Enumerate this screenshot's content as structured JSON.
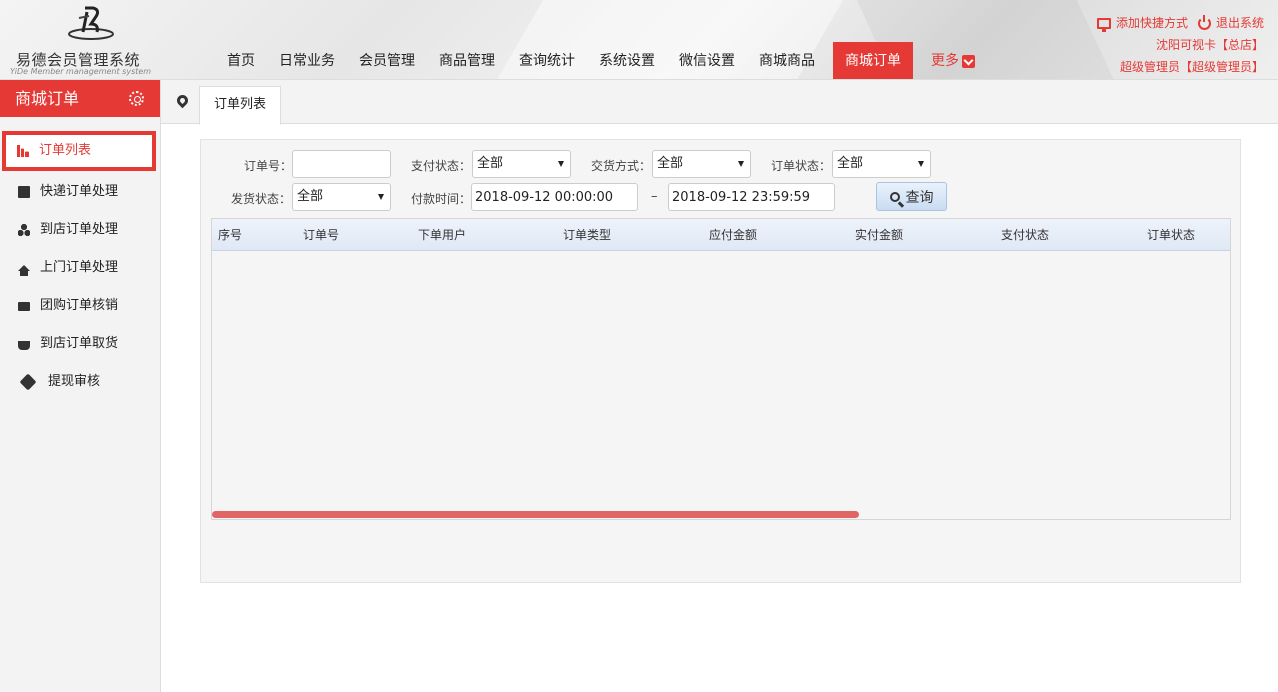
{
  "logo": {
    "title": "易德会员管理系统",
    "subtitle": "YiDe Member management system"
  },
  "nav": {
    "items": [
      "首页",
      "日常业务",
      "会员管理",
      "商品管理",
      "查询统计",
      "系统设置",
      "微信设置",
      "商城商品"
    ],
    "active": "商城订单",
    "more": "更多"
  },
  "top_right": {
    "add_shortcut": "添加快捷方式",
    "logout": "退出系统",
    "store": "沈阳可视卡【总店】",
    "user": "超级管理员【超级管理员】"
  },
  "sidebar": {
    "title": "商城订单",
    "items": [
      {
        "label": "订单列表",
        "icon": "bar-chart-icon"
      },
      {
        "label": "快递订单处理",
        "icon": "document-icon"
      },
      {
        "label": "到店订单处理",
        "icon": "cubes-icon"
      },
      {
        "label": "上门订单处理",
        "icon": "home-icon"
      },
      {
        "label": "团购订单核销",
        "icon": "mail-icon"
      },
      {
        "label": "到店订单取货",
        "icon": "basket-icon"
      },
      {
        "label": "提现审核",
        "icon": "wrench-icon"
      }
    ]
  },
  "tabs": {
    "active": "订单列表"
  },
  "filters": {
    "order_no_label": "订单号：",
    "order_no_value": "",
    "pay_status_label": "支付状态：",
    "pay_status_value": "全部",
    "delivery_method_label": "交货方式：",
    "delivery_method_value": "全部",
    "order_status_label": "订单状态：",
    "order_status_value": "全部",
    "ship_status_label": "发货状态：",
    "ship_status_value": "全部",
    "pay_time_label": "付款时间：",
    "pay_time_from": "2018-09-12 00:00:00",
    "pay_time_sep": "–",
    "pay_time_to": "2018-09-12 23:59:59",
    "search_label": "查询"
  },
  "table": {
    "columns": [
      "序号",
      "订单号",
      "下单用户",
      "订单类型",
      "应付金额",
      "实付金额",
      "支付状态",
      "订单状态"
    ],
    "rows": []
  },
  "colors": {
    "accent": "#e53935"
  }
}
